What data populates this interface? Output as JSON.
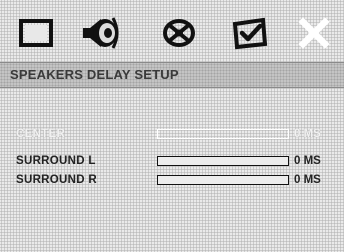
{
  "header": {
    "title": "SPEAKERS DELAY SETUP"
  },
  "icons": [
    {
      "name": "tv-screen-icon"
    },
    {
      "name": "speaker-icon"
    },
    {
      "name": "film-reel-icon"
    },
    {
      "name": "checkmark-icon"
    },
    {
      "name": "close-icon"
    }
  ],
  "settings": [
    {
      "label": "CENTER",
      "value": "0 MS",
      "level": 0,
      "highlighted": true
    },
    {
      "label": "SURROUND L",
      "value": "0 MS",
      "level": 0,
      "highlighted": false
    },
    {
      "label": "SURROUND R",
      "value": "0 MS",
      "level": 0,
      "highlighted": false
    }
  ]
}
